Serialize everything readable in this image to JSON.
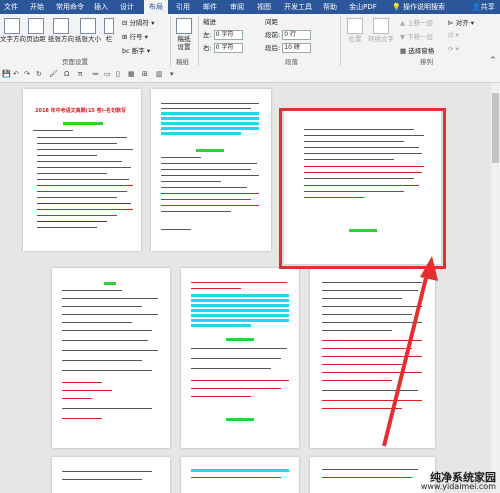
{
  "ribbon_tabs": [
    "文件",
    "开始",
    "常用命令",
    "插入",
    "设计",
    "布局",
    "引用",
    "邮件",
    "审阅",
    "视图",
    "开发工具",
    "帮助",
    "金山PDF"
  ],
  "active_tab": "布局",
  "search_label": "操作说明搜索",
  "share_label": "共享",
  "page_setup": {
    "text_direction": "文字方向",
    "margins": "页边距",
    "orientation": "纸张方向",
    "size": "纸张大小",
    "columns": "栏",
    "breaks": "分隔符",
    "line_numbers": "行号",
    "hyphenation": "断字",
    "group_label": "页面设置"
  },
  "draft": {
    "label": "稿纸\n设置",
    "group_label": "稿纸"
  },
  "paragraph": {
    "indent_label": "缩进",
    "spacing_label": "间距",
    "left_label": "左:",
    "right_label": "右:",
    "before_label": "段前:",
    "after_label": "段后:",
    "left_value": "0 字符",
    "right_value": "0 字符",
    "before_value": "0 行",
    "after_value": "10 磅",
    "group_label": "段落"
  },
  "arrange": {
    "position": "位置",
    "wrap": "环绕文字",
    "bring_forward": "上移一层",
    "send_backward": "下移一层",
    "selection_pane": "选择窗格",
    "align": "对齐",
    "group_label": "排列"
  },
  "doc": {
    "page1_title": "2018 年中考语文真题(15 卷)-名句默写"
  },
  "watermark": {
    "name": "纯净系统家园",
    "url": "www.yidaimei.com"
  },
  "colors": {
    "ribbon_blue": "#2b579a",
    "highlight_box": "#e03030",
    "arrow": "#e03030",
    "highlight_cyan": "#20d8ee",
    "highlight_green": "#32d032"
  }
}
